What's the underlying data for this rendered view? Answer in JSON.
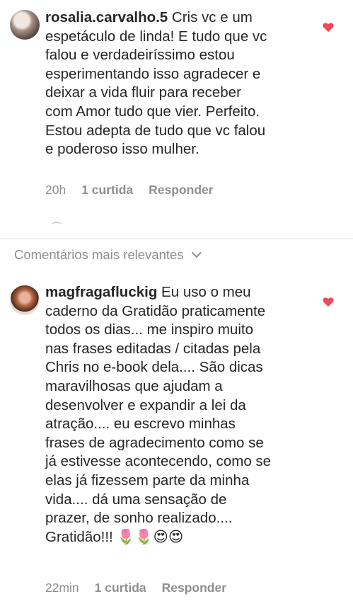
{
  "comments": [
    {
      "username": "rosalia.carvalho.5",
      "text": " Cris vc e um\nespetáculo de linda! E tudo que vc\nfalou e verdadeiríssimo estou\nesperimentando isso agradecer e\ndeixar a vida fluir para receber\ncom Amor tudo que vier. Perfeito.\nEstou adepta de tudo que vc falou\ne poderoso isso mulher.",
      "time": "20h",
      "likes": "1 curtida",
      "reply": "Responder"
    },
    {
      "username": "magfragafluckig",
      "text": " Eu uso o meu\ncaderno da Gratidão praticamente\ntodos os dias... me inspiro muito\nnas frases editadas / citadas  pela\nChris no e-book dela.... São dicas\nmaravilhosas que ajudam a\ndesenvolver e expandir a lei da\natração.... eu escrevo minhas\nfrases de agradecimento  como se\njá estivesse acontecendo, como se\nelas já fizessem parte da minha\nvida.... dá uma sensação de\nprazer, de sonho realizado....\nGratidão!!! 🌷🌷😍😍",
      "time": "22min",
      "likes": "1 curtida",
      "reply": "Responder"
    }
  ],
  "sort": {
    "label": "Comentários mais relevantes"
  },
  "colors": {
    "heart": "#ed4956",
    "meta": "#8e8e8e",
    "text": "#262626",
    "divider": "#dbdbdb"
  }
}
